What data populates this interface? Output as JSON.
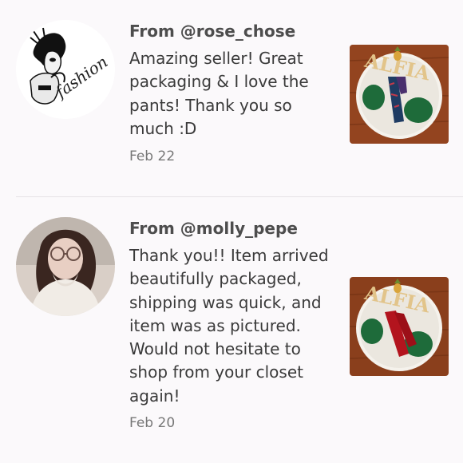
{
  "reviews": [
    {
      "from": "From @rose_chose",
      "message": "Amazing seller! Great packaging & I love the pants! Thank you so much :D",
      "date": "Feb 22",
      "avatar_icon": "fashion-sketch-avatar",
      "avatar_text": "fashion",
      "thumb_icon": "leggings-on-rug-photo",
      "thumb_text": "ALFIA",
      "item_color": "#1f3c63"
    },
    {
      "from": "From @molly_pepe",
      "message": "Thank you!! Item arrived beautifully packaged, shipping was quick, and item was as pictured. Would not hesitate to shop from your closet again!",
      "date": "Feb 20",
      "avatar_icon": "user-photo-avatar",
      "thumb_icon": "leggings-on-rug-photo",
      "thumb_text": "ALFIA",
      "item_color": "#b3141e"
    }
  ]
}
